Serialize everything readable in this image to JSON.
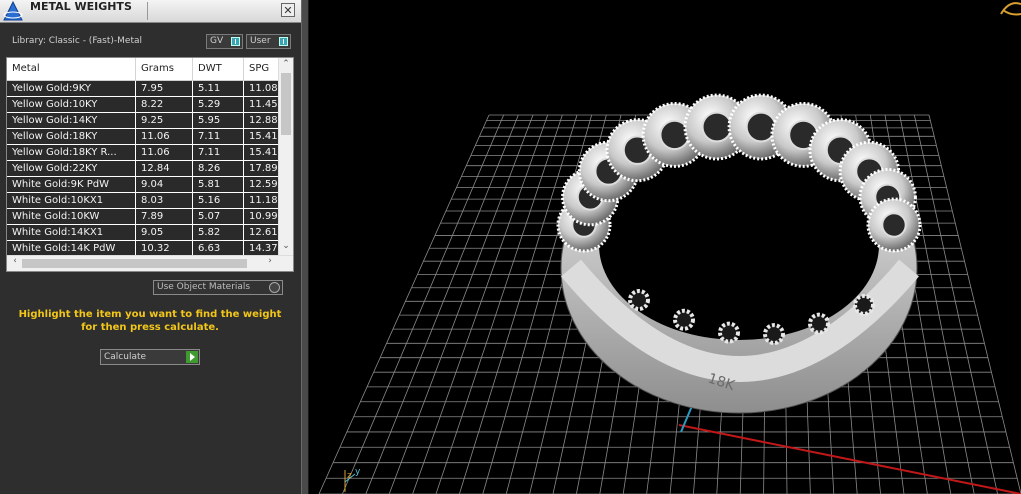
{
  "window": {
    "title": "METAL WEIGHTS",
    "close_glyph": "✕"
  },
  "library_label": "Library: Classic - (Fast)-Metal",
  "toggles": [
    {
      "label": "GV"
    },
    {
      "label": "User"
    }
  ],
  "table": {
    "columns": [
      "Metal",
      "Grams",
      "DWT",
      "SPG"
    ],
    "rows": [
      [
        "Yellow Gold:9KY",
        "7.95",
        "5.11",
        "11.08"
      ],
      [
        "Yellow Gold:10KY",
        "8.22",
        "5.29",
        "11.45"
      ],
      [
        "Yellow Gold:14KY",
        "9.25",
        "5.95",
        "12.88"
      ],
      [
        "Yellow Gold:18KY",
        "11.06",
        "7.11",
        "15.41"
      ],
      [
        "Yellow Gold:18KY R...",
        "11.06",
        "7.11",
        "15.41"
      ],
      [
        "Yellow Gold:22KY",
        "12.84",
        "8.26",
        "17.89"
      ],
      [
        "White Gold:9K PdW",
        "9.04",
        "5.81",
        "12.59"
      ],
      [
        "White Gold:10KX1",
        "8.03",
        "5.16",
        "11.18"
      ],
      [
        "White Gold:10KW",
        "7.89",
        "5.07",
        "10.99"
      ],
      [
        "White Gold:14KX1",
        "9.05",
        "5.82",
        "12.61"
      ],
      [
        "White Gold:14K PdW",
        "10.32",
        "6.63",
        "14.37"
      ]
    ]
  },
  "use_object_materials": "Use Object Materials",
  "hint": "Highlight the item you want to find the weight for then press calculate.",
  "calculate_label": "Calculate",
  "viewport": {
    "axis_y_label": "y",
    "axis_z_label": "z",
    "ring_inscription": "18K"
  },
  "colors": {
    "hint": "#f2c619",
    "accent": "#3ba6b3",
    "go": "#3f9a2f",
    "x_axis": "#c01818",
    "y_axis": "#2a9bc0",
    "grid": "#8a8a8a"
  }
}
